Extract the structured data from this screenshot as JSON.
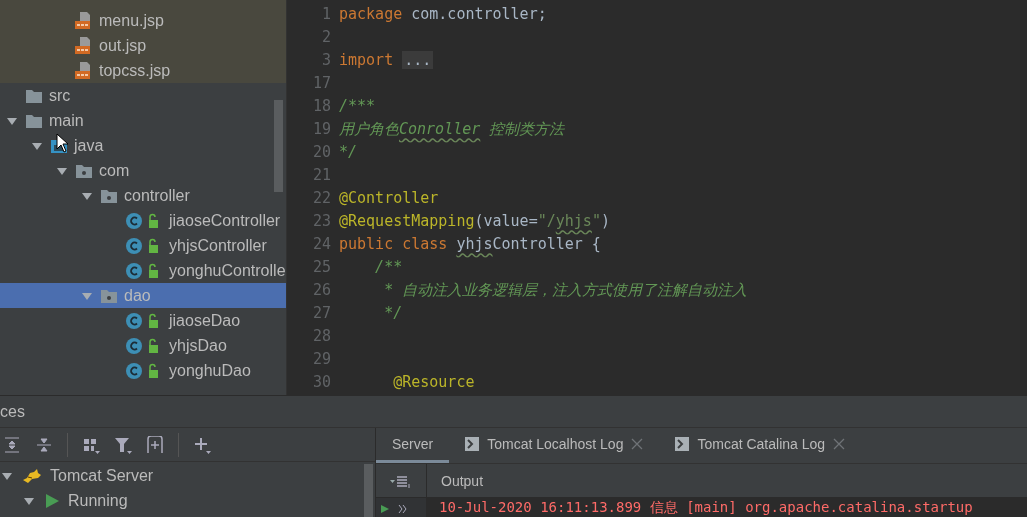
{
  "project_tree": {
    "highlighted_files": [
      {
        "name": "menu.jsp",
        "kind": "jsp",
        "selected": false
      },
      {
        "name": "out.jsp",
        "kind": "jsp",
        "selected": false
      },
      {
        "name": "topcss.jsp",
        "kind": "jsp",
        "selected": false
      }
    ],
    "items": [
      {
        "name": "src",
        "kind": "folder",
        "selected": false
      },
      {
        "name": "main",
        "kind": "folder",
        "expanded": true,
        "selected": false,
        "children": [
          {
            "name": "java",
            "kind": "source-root",
            "expanded": true,
            "selected": false,
            "children": [
              {
                "name": "com",
                "kind": "package",
                "expanded": true,
                "selected": false,
                "children": [
                  {
                    "name": "controller",
                    "kind": "package",
                    "expanded": true,
                    "selected": false,
                    "children": [
                      {
                        "name": "jiaoseController",
                        "kind": "class",
                        "selected": false
                      },
                      {
                        "name": "yhjsController",
                        "kind": "class",
                        "selected": false
                      },
                      {
                        "name": "yonghuControlle",
                        "kind": "class",
                        "selected": false
                      }
                    ]
                  },
                  {
                    "name": "dao",
                    "kind": "package",
                    "expanded": true,
                    "selected": true,
                    "children": [
                      {
                        "name": "jiaoseDao",
                        "kind": "class",
                        "selected": false
                      },
                      {
                        "name": "yhjsDao",
                        "kind": "class",
                        "selected": false
                      },
                      {
                        "name": "yonghuDao",
                        "kind": "class",
                        "selected": false
                      }
                    ]
                  }
                ]
              }
            ]
          }
        ]
      }
    ]
  },
  "editor": {
    "lines": [
      {
        "number": "1",
        "tokens": [
          {
            "kind": "keyword",
            "text": "package"
          },
          {
            "kind": "plain",
            "text": " com.controller;"
          }
        ]
      },
      {
        "number": "2"
      },
      {
        "number": "3",
        "tokens": [
          {
            "kind": "keyword",
            "text": "import "
          },
          {
            "kind": "fold",
            "text": "..."
          }
        ]
      },
      {
        "number": "17"
      },
      {
        "number": "18",
        "tokens": [
          {
            "kind": "comment",
            "text": "/***"
          }
        ]
      },
      {
        "number": "19",
        "tokens": [
          {
            "kind": "comment",
            "text": "用户角色"
          },
          {
            "kind": "comment",
            "text": "Conroller",
            "typo": true
          },
          {
            "kind": "comment",
            "text": " 控制类方法"
          }
        ]
      },
      {
        "number": "20",
        "tokens": [
          {
            "kind": "comment",
            "text": "*/"
          }
        ]
      },
      {
        "number": "21"
      },
      {
        "number": "22",
        "tokens": [
          {
            "kind": "annotation",
            "text": "@Controller"
          }
        ]
      },
      {
        "number": "23",
        "tokens": [
          {
            "kind": "annotation",
            "text": "@RequestMapping"
          },
          {
            "kind": "plain",
            "text": "(value="
          },
          {
            "kind": "string",
            "text": "\"/"
          },
          {
            "kind": "string",
            "text": "yhjs",
            "typo": true
          },
          {
            "kind": "string",
            "text": "\""
          },
          {
            "kind": "plain",
            "text": ")"
          }
        ]
      },
      {
        "number": "24",
        "tokens": [
          {
            "kind": "keyword",
            "text": "public class "
          },
          {
            "kind": "plain",
            "text": "yhjs",
            "typo": true
          },
          {
            "kind": "plain",
            "text": "Controller {"
          }
        ]
      },
      {
        "number": "25",
        "tokens": [
          {
            "kind": "comment",
            "text": "    /**"
          }
        ]
      },
      {
        "number": "26",
        "tokens": [
          {
            "kind": "comment",
            "text": "     * 自动注入业务逻辑层，注入方式使用了注解自动注入"
          }
        ]
      },
      {
        "number": "27",
        "tokens": [
          {
            "kind": "comment",
            "text": "     */"
          }
        ]
      },
      {
        "number": "28"
      },
      {
        "number": "29"
      },
      {
        "number": "30",
        "tokens": [
          {
            "kind": "annotation",
            "text": "      @Resource"
          }
        ]
      }
    ]
  },
  "services": {
    "title": "ces",
    "toolbar": [
      {
        "kind": "expand-all"
      },
      {
        "kind": "collapse-all"
      },
      {
        "kind": "separator"
      },
      {
        "kind": "group"
      },
      {
        "kind": "filter"
      },
      {
        "kind": "add-frame"
      },
      {
        "kind": "separator"
      },
      {
        "kind": "add"
      }
    ],
    "tree": [
      {
        "name": "Tomcat Server",
        "kind": "tomcat",
        "expanded": true,
        "children": [
          {
            "name": "Running",
            "kind": "running",
            "expanded": true
          }
        ]
      }
    ],
    "tabs": [
      {
        "label": "Server",
        "selected": true,
        "closable": false
      },
      {
        "label": "Tomcat Localhost Log",
        "selected": false,
        "closable": true
      },
      {
        "label": "Tomcat Catalina Log",
        "selected": false,
        "closable": true
      }
    ],
    "output_label": "Output",
    "log_lines": [
      "10-Jul-2020 16:11:13.899 信息 [main] org.apache.catalina.startup"
    ]
  }
}
